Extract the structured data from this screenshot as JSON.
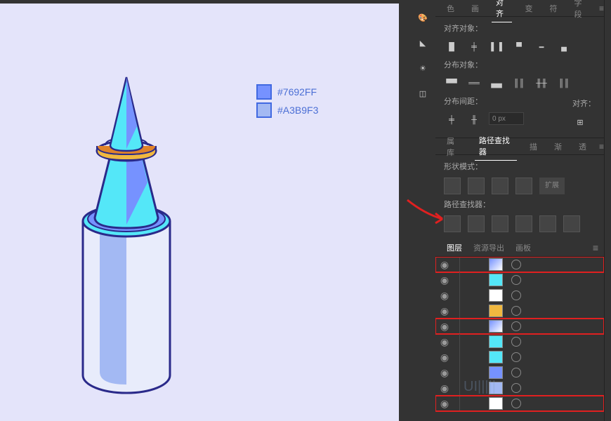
{
  "swatches": [
    {
      "color": "#7692FF",
      "label": "#7692FF"
    },
    {
      "color": "#A3B9F3",
      "label": "#A3B9F3"
    }
  ],
  "top_tabs": {
    "color": "色",
    "stroke": "画",
    "align": "对齐",
    "transform": "变",
    "ch": "符",
    "pg": "字段"
  },
  "align_panel": {
    "label1": "对齐对象：",
    "label2": "分布对象：",
    "label3": "分布间距：",
    "label4": "对齐：",
    "px_value": "0 px"
  },
  "pathfinder": {
    "tab1": "属 库",
    "tab2": "路径查找器",
    "tab3": "描",
    "tab4": "渐",
    "tab5": "透",
    "shape_label": "形状模式：",
    "expand": "扩展",
    "pf_label": "路径查找器："
  },
  "layers": {
    "tab1": "图层",
    "tab2": "资源导出",
    "tab3": "画板"
  },
  "watermark": "UI|||||"
}
